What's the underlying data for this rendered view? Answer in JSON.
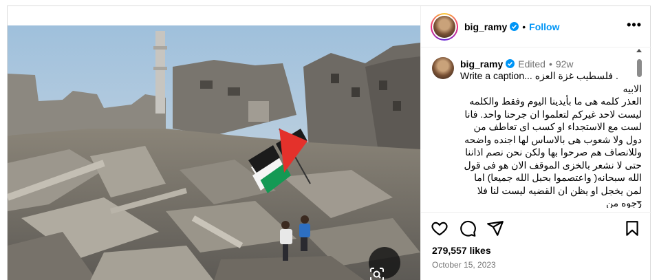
{
  "post": {
    "username": "big_ramy",
    "follow_label": "Follow",
    "more_label": "•••",
    "separator": "•"
  },
  "caption": {
    "username": "big_ramy",
    "edited_label": "Edited",
    "separator": "•",
    "age": "92w",
    "line_en": "Write a caption... فلسطيب غزة العزه .",
    "line_ar_1": "الابيه",
    "body_ar": "العذر كلمه هى ما بأيدينا اليوم وفقط والكلمه ليست لاحد غيركم لتعلموا ان جرحنا واحد. فانا لست مع الاستجداء  او كسب اى تعاطف من دول ولا شعوب هى بالاساس لها اجنده واضحه وللانصاف هم صرحوا بها ولكن نحن نصم اذاننا حتى  لا نشعر بالخزى الموقف الان هو فى قول الله سبحانه( واعتصموا بحبل الله جميعا) اما لمن يخجل او يظن ان القضيه ليست لنا فلا رجوه من"
  },
  "actions": {
    "like_icon": "heart-icon",
    "comment_icon": "comment-icon",
    "share_icon": "paper-plane-icon",
    "save_icon": "bookmark-icon"
  },
  "likes_text": "279,557 likes",
  "date_text": "October 15, 2023",
  "colors": {
    "link_blue": "#0095f6",
    "secondary_text": "#737373",
    "border": "#dbdbdb",
    "flag_red": "#e4312b",
    "flag_green": "#149954"
  }
}
